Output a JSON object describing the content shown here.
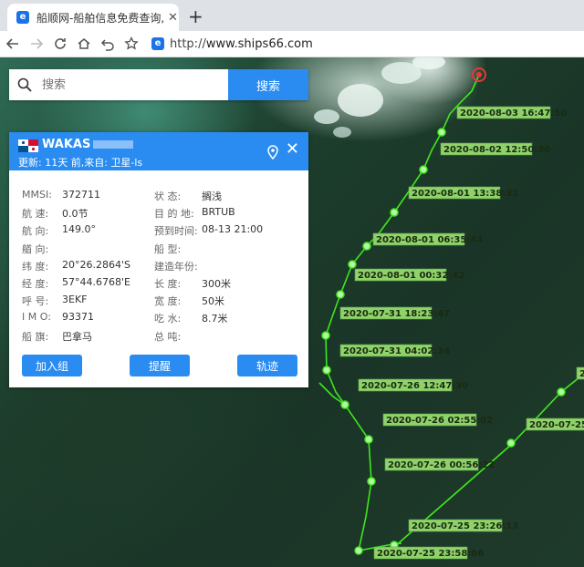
{
  "browser": {
    "tab_title": "船顺网-船舶信息免费查询,船舶动",
    "tab_favicon": "e",
    "url_scheme": "http://",
    "url_host": "www.ships66.com"
  },
  "search": {
    "placeholder": "搜索",
    "button_label": "搜索"
  },
  "ship": {
    "name": "WAKAS",
    "update_text": "更新: 11天 前,来自: 卫星-ls",
    "left_fields": [
      {
        "label": "MMSI:",
        "value": "372711"
      },
      {
        "label": "航  速:",
        "value": "0.0节"
      },
      {
        "label": "航  向:",
        "value": "149.0°"
      },
      {
        "label": "艏  向:",
        "value": ""
      },
      {
        "label": "纬  度:",
        "value": "20°26.2864'S"
      },
      {
        "label": "经  度:",
        "value": "57°44.6768'E"
      },
      {
        "label": "呼  号:",
        "value": "3EKF"
      },
      {
        "label": "I M O:",
        "value": "93371"
      },
      {
        "label": "船  旗:",
        "value": "巴拿马"
      }
    ],
    "right_fields": [
      {
        "label": "状    态:",
        "value": "搁浅"
      },
      {
        "label": "目 的 地:",
        "value": "BRTUB"
      },
      {
        "label": "预到时间:",
        "value": "08-13 21:00"
      },
      {
        "label": "船    型:",
        "value": ""
      },
      {
        "label": "建造年份:",
        "value": ""
      },
      {
        "label": "长    度:",
        "value": "300米"
      },
      {
        "label": "宽    度:",
        "value": "50米"
      },
      {
        "label": "吃    水:",
        "value": "8.7米"
      },
      {
        "label": "总    吨:",
        "value": ""
      }
    ],
    "buttons": {
      "add_group": "加入组",
      "remind": "提醒",
      "track": "轨迹"
    }
  },
  "track_labels": [
    "2020-08-03 16:47:50",
    "2020-08-02 12:50:30",
    "2020-08-01 13:38:31",
    "2020-08-01 06:35:44",
    "2020-08-01 00:32:42",
    "2020-07-31 18:23:47",
    "2020-07-31 04:02:34",
    "2020-07-26 12:47:30",
    "2020-07-26 02:55:02",
    "2020-07-26 00:56:22",
    "2020-07-25 23:26:13",
    "2020-07-25 23:58:06",
    "2020-07-25 2",
    "20"
  ],
  "colors": {
    "track": "#3ee81c",
    "track_label_bg": "#8fd26a",
    "accent_blue": "#2a8cf0",
    "ship_marker": "#e53935"
  }
}
